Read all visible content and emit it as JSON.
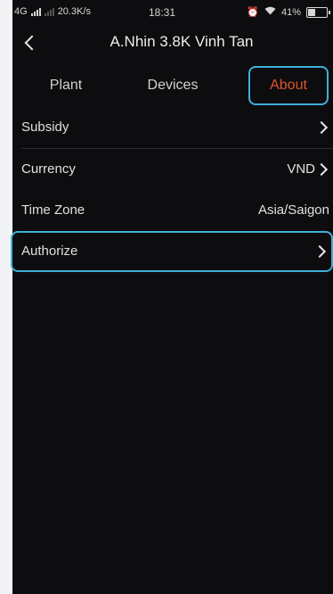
{
  "status_bar": {
    "network": "4G",
    "speed": "20.3K/s",
    "time": "18:31",
    "battery": "41%",
    "battery_level": 0.41,
    "icons": [
      "signal-icon",
      "alarm-icon",
      "wifi-icon",
      "battery-icon"
    ]
  },
  "header": {
    "title": "A.Nhin 3.8K Vinh Tan"
  },
  "tabs": [
    {
      "label": "Plant",
      "active": false
    },
    {
      "label": "Devices",
      "active": false
    },
    {
      "label": "About",
      "active": true
    }
  ],
  "colors": {
    "accent": "#e0532e",
    "highlight": "#3fb0d8",
    "background": "#0d0d0f"
  },
  "settings": [
    {
      "label": "Subsidy",
      "value": "",
      "arrow": true
    },
    {
      "label": "Currency",
      "value": "VND",
      "arrow": true
    },
    {
      "label": "Time Zone",
      "value": "Asia/Saigon",
      "arrow": false
    },
    {
      "label": "Authorize",
      "value": "",
      "arrow": true
    }
  ]
}
